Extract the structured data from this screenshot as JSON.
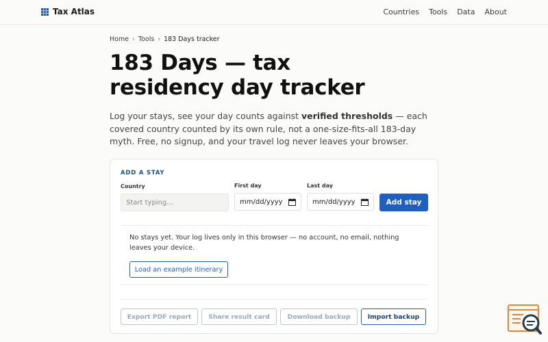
{
  "header": {
    "brand": "Tax Atlas",
    "nav": [
      "Countries",
      "Tools",
      "Data",
      "About"
    ]
  },
  "breadcrumb": {
    "items": [
      "Home",
      "Tools",
      "183 Days tracker"
    ],
    "separator": "›"
  },
  "page": {
    "title": "183 Days — tax residency day tracker",
    "intro_before": "Log your stays, see your day counts against ",
    "intro_bold": "verified thresholds",
    "intro_after": " — each covered country counted by its own rule, not a one-size-fits-all 183-day myth. Free, no signup, and your travel log never leaves your browser."
  },
  "add_stay": {
    "section_label": "ADD A STAY",
    "country_label": "Country",
    "country_placeholder": "Start typing…",
    "first_day_label": "First day",
    "first_day_value": "mm/dd/yyyy",
    "last_day_label": "Last day",
    "last_day_value": "mm/dd/yyyy",
    "add_button": "Add stay"
  },
  "empty_state": {
    "message": "No stays yet. Your log lives only in this browser — no account, no email, nothing leaves your device.",
    "example_button": "Load an example itinerary"
  },
  "actions": {
    "export_pdf": "Export PDF report",
    "share_card": "Share result card",
    "download_backup": "Download backup",
    "import_backup": "Import backup"
  },
  "colors": {
    "accent": "#1f5fbf",
    "section_label": "#1d4f7c",
    "disabled_text": "#9aa9b8"
  }
}
